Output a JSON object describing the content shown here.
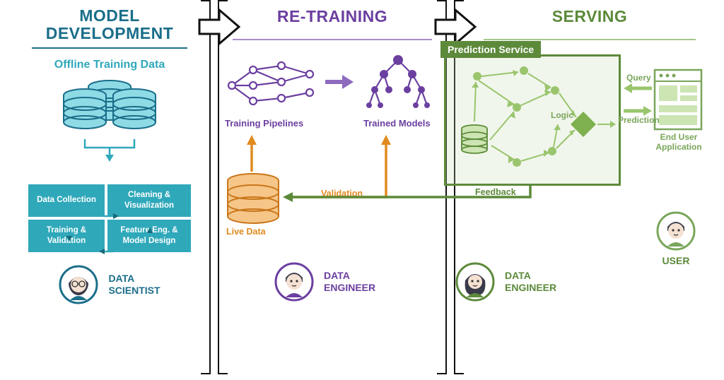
{
  "sections": {
    "model_development": {
      "title": "MODEL DEVELOPMENT",
      "subhead": "Offline Training Data",
      "cards": {
        "data_collection": "Data Collection",
        "cleaning_visualization": "Cleaning & Visualization",
        "training_validation": "Training & Validation",
        "feature_model": "Feature Eng. & Model Design"
      },
      "role": "DATA SCIENTIST"
    },
    "retraining": {
      "title": "RE-TRAINING",
      "training_pipelines": "Training Pipelines",
      "trained_models": "Trained Models",
      "validation": "Validation",
      "live_data": "Live Data",
      "role": "DATA ENGINEER"
    },
    "serving": {
      "title": "SERVING",
      "prediction_service": "Prediction Service",
      "logic": "Logic",
      "feedback": "Feedback",
      "query": "Query",
      "prediction": "Prediction",
      "end_user_app": "End User Application",
      "role_engineer": "DATA ENGINEER",
      "role_user": "USER"
    }
  }
}
